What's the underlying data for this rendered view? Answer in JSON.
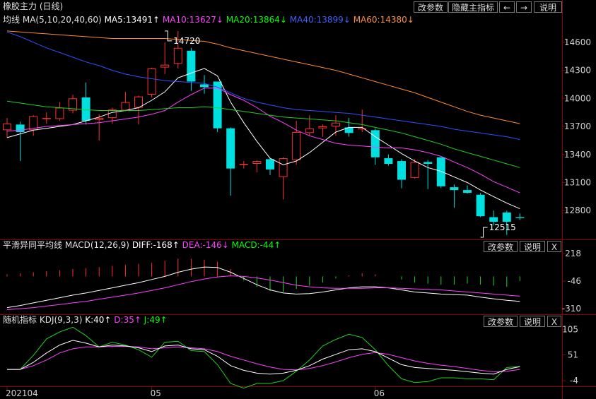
{
  "header": {
    "title": "橡胶主力 (日线)",
    "buttons": [
      "改参数",
      "隐藏主指标",
      "←",
      "→",
      "说明"
    ]
  },
  "ma_legend": {
    "name": "均线",
    "params": "MA(5,10,20,40,60)",
    "ma5": "MA5:13491↑",
    "ma10": "MA10:13627↓",
    "ma20": "MA20:13864↓",
    "ma40": "MA40:13899↓",
    "ma60": "MA60:14380↓"
  },
  "macd_legend": {
    "name": "平滑异同平均线",
    "params": "MACD(12,26,9)",
    "diff": "DIFF:-168↑",
    "dea": "DEA:-146↓",
    "macd": "MACD:-44↑",
    "buttons": [
      "改参数",
      "说明",
      "X"
    ]
  },
  "kdj_legend": {
    "name": "随机指标",
    "params": "KDJ(9,3,3)",
    "k": "K:40↑",
    "d": "D:35↑",
    "j": "J:49↑",
    "buttons": [
      "改参数",
      "说明",
      "X"
    ]
  },
  "colors": {
    "up": "#ff3030",
    "down": "#00e0e0",
    "ma5": "#ffffff",
    "ma10": "#ff40ff",
    "ma20": "#20d020",
    "ma40": "#3050ff",
    "ma60": "#ff8a30",
    "grid": "#8a0000",
    "legend_ma5": "#ffffff",
    "legend_ma10": "#ff40ff",
    "legend_ma20": "#00ff00",
    "legend_ma40": "#4060ff",
    "legend_ma60": "#ff9040"
  },
  "chart_data": [
    {
      "type": "candlestick",
      "title": "橡胶主力 (日线)",
      "yticks": [
        14600,
        14300,
        14000,
        13700,
        13400,
        13100,
        12800
      ],
      "ylim": [
        12545,
        14780
      ],
      "annotations": [
        {
          "label": "14720",
          "value": 14720,
          "index": 12
        },
        {
          "label": "12515",
          "value": 12515,
          "index": 36
        }
      ],
      "candles": [
        {
          "o": 13660,
          "h": 13790,
          "l": 13580,
          "c": 13730
        },
        {
          "o": 13720,
          "h": 13750,
          "l": 13330,
          "c": 13640
        },
        {
          "o": 13660,
          "h": 13820,
          "l": 13600,
          "c": 13810
        },
        {
          "o": 13790,
          "h": 13850,
          "l": 13730,
          "c": 13790
        },
        {
          "o": 13780,
          "h": 13960,
          "l": 13760,
          "c": 13900
        },
        {
          "o": 13870,
          "h": 14040,
          "l": 13840,
          "c": 14000
        },
        {
          "o": 14010,
          "h": 14170,
          "l": 13720,
          "c": 13760
        },
        {
          "o": 13770,
          "h": 13830,
          "l": 13550,
          "c": 13790
        },
        {
          "o": 13790,
          "h": 13900,
          "l": 13730,
          "c": 13880
        },
        {
          "o": 13870,
          "h": 14070,
          "l": 13860,
          "c": 13960
        },
        {
          "o": 13900,
          "h": 14030,
          "l": 13720,
          "c": 14020
        },
        {
          "o": 14040,
          "h": 14330,
          "l": 14010,
          "c": 14320
        },
        {
          "o": 14330,
          "h": 14600,
          "l": 14260,
          "c": 14360
        },
        {
          "o": 14370,
          "h": 14720,
          "l": 14320,
          "c": 14540
        },
        {
          "o": 14510,
          "h": 14540,
          "l": 14080,
          "c": 14180
        },
        {
          "o": 14150,
          "h": 14250,
          "l": 14050,
          "c": 14120
        },
        {
          "o": 14180,
          "h": 14180,
          "l": 13640,
          "c": 13680
        },
        {
          "o": 13680,
          "h": 13690,
          "l": 12960,
          "c": 13250
        },
        {
          "o": 13290,
          "h": 13330,
          "l": 13250,
          "c": 13300
        },
        {
          "o": 13300,
          "h": 13340,
          "l": 13210,
          "c": 13330
        },
        {
          "o": 13350,
          "h": 13360,
          "l": 13180,
          "c": 13240
        },
        {
          "o": 13160,
          "h": 13370,
          "l": 12920,
          "c": 13360
        },
        {
          "o": 13340,
          "h": 13760,
          "l": 13290,
          "c": 13640
        },
        {
          "o": 13630,
          "h": 13820,
          "l": 13600,
          "c": 13680
        },
        {
          "o": 13680,
          "h": 13720,
          "l": 13590,
          "c": 13700
        },
        {
          "o": 13700,
          "h": 13820,
          "l": 13600,
          "c": 13740
        },
        {
          "o": 13690,
          "h": 13790,
          "l": 13590,
          "c": 13630
        },
        {
          "o": 13680,
          "h": 13880,
          "l": 13640,
          "c": 13680
        },
        {
          "o": 13660,
          "h": 13680,
          "l": 13290,
          "c": 13370
        },
        {
          "o": 13360,
          "h": 13400,
          "l": 13280,
          "c": 13300
        },
        {
          "o": 13330,
          "h": 13350,
          "l": 13040,
          "c": 13130
        },
        {
          "o": 13150,
          "h": 13350,
          "l": 13140,
          "c": 13320
        },
        {
          "o": 13320,
          "h": 13340,
          "l": 13030,
          "c": 13300
        },
        {
          "o": 13370,
          "h": 13370,
          "l": 13040,
          "c": 13060
        },
        {
          "o": 13050,
          "h": 13080,
          "l": 12830,
          "c": 13020
        },
        {
          "o": 13020,
          "h": 13070,
          "l": 12980,
          "c": 12990
        },
        {
          "o": 12970,
          "h": 12990,
          "l": 12730,
          "c": 12740
        },
        {
          "o": 12730,
          "h": 12800,
          "l": 12640,
          "c": 12680
        },
        {
          "o": 12780,
          "h": 12800,
          "l": 12540,
          "c": 12680
        },
        {
          "o": 12730,
          "h": 12770,
          "l": 12700,
          "c": 12720
        }
      ],
      "series": [
        {
          "name": "MA5",
          "values": [
            13580,
            13620,
            13660,
            13680,
            13700,
            13720,
            13760,
            13800,
            13850,
            13870,
            13900,
            13980,
            14070,
            14220,
            14270,
            14320,
            14240,
            13960,
            13740,
            13540,
            13360,
            13290,
            13330,
            13420,
            13530,
            13640,
            13690,
            13690,
            13590,
            13500,
            13410,
            13330,
            13260,
            13220,
            13160,
            13100,
            13020,
            12950,
            12880,
            12820
          ]
        },
        {
          "name": "MA10",
          "values": [
            13650,
            13660,
            13680,
            13700,
            13710,
            13720,
            13730,
            13740,
            13760,
            13780,
            13800,
            13830,
            13870,
            13960,
            14040,
            14110,
            14110,
            14040,
            13980,
            13900,
            13810,
            13740,
            13660,
            13600,
            13560,
            13520,
            13500,
            13490,
            13480,
            13470,
            13470,
            13450,
            13420,
            13380,
            13320,
            13260,
            13190,
            13110,
            13050,
            12990
          ]
        },
        {
          "name": "MA20",
          "values": [
            13970,
            13950,
            13930,
            13910,
            13900,
            13890,
            13880,
            13870,
            13870,
            13870,
            13870,
            13880,
            13890,
            13900,
            13900,
            13910,
            13900,
            13880,
            13860,
            13840,
            13820,
            13800,
            13790,
            13780,
            13770,
            13760,
            13740,
            13720,
            13690,
            13660,
            13630,
            13590,
            13550,
            13510,
            13460,
            13420,
            13380,
            13340,
            13300,
            13260
          ]
        },
        {
          "name": "MA40",
          "values": [
            14710,
            14660,
            14600,
            14540,
            14490,
            14440,
            14390,
            14350,
            14300,
            14260,
            14230,
            14210,
            14190,
            14180,
            14170,
            14160,
            14120,
            14060,
            14000,
            13960,
            13930,
            13900,
            13880,
            13870,
            13860,
            13850,
            13840,
            13820,
            13800,
            13780,
            13760,
            13740,
            13720,
            13700,
            13670,
            13650,
            13630,
            13610,
            13590,
            13560
          ]
        },
        {
          "name": "MA60",
          "values": [
            14720,
            14710,
            14700,
            14690,
            14680,
            14670,
            14660,
            14650,
            14640,
            14640,
            14640,
            14640,
            14640,
            14630,
            14620,
            14610,
            14580,
            14540,
            14510,
            14480,
            14450,
            14420,
            14390,
            14360,
            14330,
            14300,
            14260,
            14220,
            14180,
            14140,
            14100,
            14060,
            14010,
            13960,
            13910,
            13860,
            13820,
            13790,
            13760,
            13730
          ]
        }
      ]
    },
    {
      "type": "bar+line",
      "title": "平滑异同平均线",
      "yticks": [
        218,
        -46,
        -310
      ],
      "ylim": [
        -330,
        240
      ],
      "series": [
        {
          "name": "DIFF",
          "values": [
            -300,
            -280,
            -255,
            -230,
            -205,
            -180,
            -160,
            -135,
            -110,
            -85,
            -60,
            -30,
            0,
            40,
            70,
            90,
            85,
            40,
            -20,
            -80,
            -130,
            -160,
            -170,
            -165,
            -150,
            -130,
            -110,
            -100,
            -100,
            -110,
            -130,
            -150,
            -160,
            -170,
            -175,
            -180,
            -200,
            -215,
            -230,
            -240
          ]
        },
        {
          "name": "DEA",
          "values": [
            -320,
            -310,
            -300,
            -285,
            -270,
            -255,
            -240,
            -220,
            -200,
            -180,
            -160,
            -135,
            -110,
            -80,
            -50,
            -25,
            -5,
            5,
            0,
            -15,
            -35,
            -60,
            -85,
            -100,
            -110,
            -115,
            -115,
            -115,
            -110,
            -110,
            -115,
            -120,
            -125,
            -130,
            -140,
            -150,
            -160,
            -170,
            -180,
            -190
          ]
        },
        {
          "name": "MACD",
          "values": [
            20,
            30,
            40,
            50,
            60,
            70,
            80,
            90,
            100,
            110,
            120,
            130,
            150,
            170,
            170,
            160,
            140,
            70,
            -40,
            -100,
            -140,
            -150,
            -120,
            -90,
            -60,
            -20,
            10,
            30,
            20,
            0,
            -30,
            -60,
            -70,
            -80,
            -80,
            -70,
            -80,
            -90,
            -100,
            -44
          ]
        }
      ]
    },
    {
      "type": "line",
      "title": "随机指标",
      "yticks": [
        105,
        51,
        -4
      ],
      "ylim": [
        -10,
        112
      ],
      "xticks": [
        {
          "index": 0,
          "label": "202104"
        },
        {
          "index": 11,
          "label": "05"
        },
        {
          "index": 28,
          "label": "06"
        }
      ],
      "series": [
        {
          "name": "K",
          "values": [
            20,
            20,
            35,
            55,
            72,
            82,
            76,
            68,
            72,
            70,
            66,
            58,
            70,
            72,
            64,
            62,
            48,
            28,
            18,
            12,
            10,
            12,
            18,
            28,
            42,
            52,
            62,
            64,
            58,
            44,
            30,
            24,
            22,
            20,
            18,
            15,
            12,
            10,
            20,
            26
          ]
        },
        {
          "name": "D",
          "values": [
            20,
            20,
            28,
            40,
            55,
            64,
            68,
            68,
            69,
            69,
            68,
            64,
            66,
            68,
            66,
            64,
            58,
            48,
            40,
            32,
            25,
            20,
            19,
            22,
            28,
            36,
            45,
            52,
            56,
            52,
            45,
            38,
            33,
            29,
            26,
            22,
            18,
            15,
            16,
            20
          ]
        },
        {
          "name": "J",
          "values": [
            20,
            20,
            50,
            85,
            100,
            110,
            92,
            68,
            78,
            72,
            62,
            46,
            78,
            80,
            60,
            58,
            30,
            -10,
            -20,
            -10,
            -10,
            -4,
            16,
            40,
            70,
            84,
            95,
            88,
            62,
            28,
            0,
            -8,
            -6,
            2,
            2,
            0,
            0,
            -2,
            24,
            26
          ]
        }
      ]
    }
  ]
}
